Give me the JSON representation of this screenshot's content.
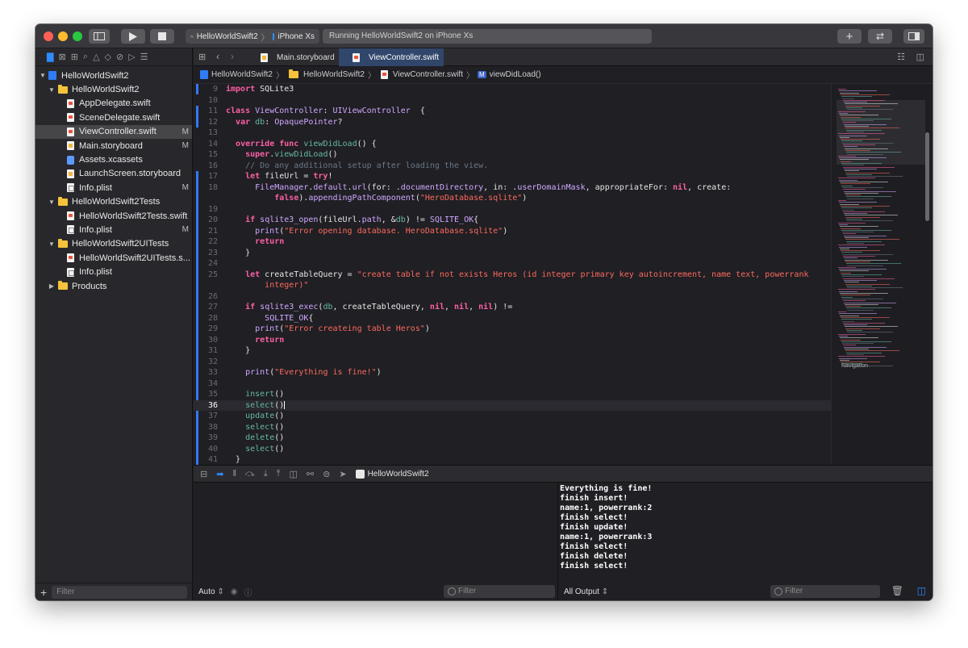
{
  "toolbar": {
    "scheme": "HelloWorldSwift2",
    "device": "iPhone Xs",
    "status": "Running HelloWorldSwift2 on iPhone Xs"
  },
  "navigator": {
    "items": [
      {
        "label": "HelloWorldSwift2",
        "kind": "project",
        "level": 0,
        "expanded": true,
        "badge": ""
      },
      {
        "label": "HelloWorldSwift2",
        "kind": "folder",
        "level": 1,
        "expanded": true,
        "badge": ""
      },
      {
        "label": "AppDelegate.swift",
        "kind": "swift",
        "level": 2,
        "badge": ""
      },
      {
        "label": "SceneDelegate.swift",
        "kind": "swift",
        "level": 2,
        "badge": ""
      },
      {
        "label": "ViewController.swift",
        "kind": "swift",
        "level": 2,
        "badge": "M",
        "selected": true
      },
      {
        "label": "Main.storyboard",
        "kind": "story",
        "level": 2,
        "badge": "M"
      },
      {
        "label": "Assets.xcassets",
        "kind": "assets",
        "level": 2,
        "badge": ""
      },
      {
        "label": "LaunchScreen.storyboard",
        "kind": "story",
        "level": 2,
        "badge": ""
      },
      {
        "label": "Info.plist",
        "kind": "plist",
        "level": 2,
        "badge": "M"
      },
      {
        "label": "HelloWorldSwift2Tests",
        "kind": "folder",
        "level": 1,
        "expanded": true,
        "badge": ""
      },
      {
        "label": "HelloWorldSwift2Tests.swift",
        "kind": "swift",
        "level": 2,
        "badge": ""
      },
      {
        "label": "Info.plist",
        "kind": "plist",
        "level": 2,
        "badge": "M"
      },
      {
        "label": "HelloWorldSwift2UITests",
        "kind": "folder",
        "level": 1,
        "expanded": true,
        "badge": ""
      },
      {
        "label": "HelloWorldSwift2UITests.s...",
        "kind": "swift",
        "level": 2,
        "badge": ""
      },
      {
        "label": "Info.plist",
        "kind": "plist",
        "level": 2,
        "badge": ""
      },
      {
        "label": "Products",
        "kind": "folder",
        "level": 1,
        "expanded": false,
        "badge": ""
      }
    ],
    "filter_placeholder": "Filter"
  },
  "tabs": [
    {
      "label": "Main.storyboard",
      "active": false
    },
    {
      "label": "ViewController.swift",
      "active": true
    }
  ],
  "jumpbar": {
    "project": "HelloWorldSwift2",
    "group": "HelloWorldSwift2",
    "file": "ViewController.swift",
    "symbol_badge": "M",
    "symbol": "viewDidLoad()"
  },
  "code_lines": [
    {
      "n": "9",
      "tokens": [
        [
          "kw",
          "import"
        ],
        [
          "t",
          " SQLite3"
        ]
      ]
    },
    {
      "n": "10",
      "tokens": []
    },
    {
      "n": "11",
      "tokens": [
        [
          "kw",
          "class"
        ],
        [
          "t",
          " "
        ],
        [
          "ty",
          "ViewController"
        ],
        [
          "t",
          ": "
        ],
        [
          "ty",
          "UIViewController"
        ],
        [
          "t",
          "  {"
        ]
      ]
    },
    {
      "n": "12",
      "tokens": [
        [
          "t",
          "  "
        ],
        [
          "kw",
          "var"
        ],
        [
          "t",
          " "
        ],
        [
          "fn",
          "db"
        ],
        [
          "t",
          ": "
        ],
        [
          "ty",
          "OpaquePointer"
        ],
        [
          "t",
          "?"
        ]
      ]
    },
    {
      "n": "13",
      "tokens": []
    },
    {
      "n": "14",
      "tokens": [
        [
          "t",
          "  "
        ],
        [
          "kw",
          "override"
        ],
        [
          "t",
          " "
        ],
        [
          "kw",
          "func"
        ],
        [
          "t",
          " "
        ],
        [
          "fn",
          "viewDidLoad"
        ],
        [
          "t",
          "() {"
        ]
      ]
    },
    {
      "n": "15",
      "tokens": [
        [
          "t",
          "    "
        ],
        [
          "kw",
          "super"
        ],
        [
          "t",
          "."
        ],
        [
          "fn",
          "viewDidLoad"
        ],
        [
          "t",
          "()"
        ]
      ]
    },
    {
      "n": "16",
      "tokens": [
        [
          "t",
          "    "
        ],
        [
          "cm",
          "// Do any additional setup after loading the view."
        ]
      ]
    },
    {
      "n": "17",
      "tokens": [
        [
          "t",
          "    "
        ],
        [
          "kw",
          "let"
        ],
        [
          "t",
          " fileUrl = "
        ],
        [
          "kw",
          "try"
        ],
        [
          "t",
          "!"
        ]
      ]
    },
    {
      "n": "18",
      "tokens": [
        [
          "t",
          "      "
        ],
        [
          "ty",
          "FileManager"
        ],
        [
          "t",
          "."
        ],
        [
          "ty",
          "default"
        ],
        [
          "t",
          "."
        ],
        [
          "ty",
          "url"
        ],
        [
          "t",
          "(for: ."
        ],
        [
          "ty",
          "documentDirectory"
        ],
        [
          "t",
          ", in: ."
        ],
        [
          "ty",
          "userDomainMask"
        ],
        [
          "t",
          ", appropriateFor: "
        ],
        [
          "kw",
          "nil"
        ],
        [
          "t",
          ", create:"
        ]
      ]
    },
    {
      "n": "",
      "tokens": [
        [
          "t",
          "          "
        ],
        [
          "kw",
          "false"
        ],
        [
          "t",
          ")."
        ],
        [
          "ty",
          "appendingPathComponent"
        ],
        [
          "t",
          "("
        ],
        [
          "str",
          "\"HeroDatabase.sqlite\""
        ],
        [
          "t",
          ")"
        ]
      ]
    },
    {
      "n": "19",
      "tokens": []
    },
    {
      "n": "20",
      "tokens": [
        [
          "t",
          "    "
        ],
        [
          "kw",
          "if"
        ],
        [
          "t",
          " "
        ],
        [
          "ty",
          "sqlite3_open"
        ],
        [
          "t",
          "(fileUrl."
        ],
        [
          "ty",
          "path"
        ],
        [
          "t",
          ", &"
        ],
        [
          "fn",
          "db"
        ],
        [
          "t",
          ") != "
        ],
        [
          "ty",
          "SQLITE_OK"
        ],
        [
          "t",
          "{"
        ]
      ]
    },
    {
      "n": "21",
      "tokens": [
        [
          "t",
          "      "
        ],
        [
          "ty",
          "print"
        ],
        [
          "t",
          "("
        ],
        [
          "str",
          "\"Error opening database. HeroDatabase.sqlite\""
        ],
        [
          "t",
          ")"
        ]
      ]
    },
    {
      "n": "22",
      "tokens": [
        [
          "t",
          "      "
        ],
        [
          "kw",
          "return"
        ]
      ]
    },
    {
      "n": "23",
      "tokens": [
        [
          "t",
          "    }"
        ]
      ]
    },
    {
      "n": "24",
      "tokens": []
    },
    {
      "n": "25",
      "tokens": [
        [
          "t",
          "    "
        ],
        [
          "kw",
          "let"
        ],
        [
          "t",
          " createTableQuery = "
        ],
        [
          "str",
          "\"create table if not exists Heros (id integer primary key autoincrement, name text, powerrank"
        ]
      ]
    },
    {
      "n": "",
      "tokens": [
        [
          "t",
          "        "
        ],
        [
          "str",
          "integer)\""
        ]
      ]
    },
    {
      "n": "26",
      "tokens": []
    },
    {
      "n": "27",
      "tokens": [
        [
          "t",
          "    "
        ],
        [
          "kw",
          "if"
        ],
        [
          "t",
          " "
        ],
        [
          "ty",
          "sqlite3_exec"
        ],
        [
          "t",
          "("
        ],
        [
          "fn",
          "db"
        ],
        [
          "t",
          ", createTableQuery, "
        ],
        [
          "kw",
          "nil"
        ],
        [
          "t",
          ", "
        ],
        [
          "kw",
          "nil"
        ],
        [
          "t",
          ", "
        ],
        [
          "kw",
          "nil"
        ],
        [
          "t",
          ") !="
        ]
      ]
    },
    {
      "n": "28",
      "tokens": [
        [
          "t",
          "        "
        ],
        [
          "ty",
          "SQLITE_OK"
        ],
        [
          "t",
          "{"
        ]
      ]
    },
    {
      "n": "29",
      "tokens": [
        [
          "t",
          "      "
        ],
        [
          "ty",
          "print"
        ],
        [
          "t",
          "("
        ],
        [
          "str",
          "\"Error createing table Heros\""
        ],
        [
          "t",
          ")"
        ]
      ]
    },
    {
      "n": "30",
      "tokens": [
        [
          "t",
          "      "
        ],
        [
          "kw",
          "return"
        ]
      ]
    },
    {
      "n": "31",
      "tokens": [
        [
          "t",
          "    }"
        ]
      ]
    },
    {
      "n": "32",
      "tokens": []
    },
    {
      "n": "33",
      "tokens": [
        [
          "t",
          "    "
        ],
        [
          "ty",
          "print"
        ],
        [
          "t",
          "("
        ],
        [
          "str",
          "\"Everything is fine!\""
        ],
        [
          "t",
          ")"
        ]
      ]
    },
    {
      "n": "34",
      "tokens": []
    },
    {
      "n": "35",
      "tokens": [
        [
          "t",
          "    "
        ],
        [
          "fn",
          "insert"
        ],
        [
          "t",
          "()"
        ]
      ]
    },
    {
      "n": "36",
      "tokens": [
        [
          "t",
          "    "
        ],
        [
          "fn",
          "select"
        ],
        [
          "t",
          "()"
        ]
      ],
      "current": true
    },
    {
      "n": "37",
      "tokens": [
        [
          "t",
          "    "
        ],
        [
          "fn",
          "update"
        ],
        [
          "t",
          "()"
        ]
      ]
    },
    {
      "n": "38",
      "tokens": [
        [
          "t",
          "    "
        ],
        [
          "fn",
          "select"
        ],
        [
          "t",
          "()"
        ]
      ]
    },
    {
      "n": "39",
      "tokens": [
        [
          "t",
          "    "
        ],
        [
          "fn",
          "delete"
        ],
        [
          "t",
          "()"
        ]
      ]
    },
    {
      "n": "40",
      "tokens": [
        [
          "t",
          "    "
        ],
        [
          "fn",
          "select"
        ],
        [
          "t",
          "()"
        ]
      ]
    },
    {
      "n": "41",
      "tokens": [
        [
          "t",
          "  }"
        ]
      ]
    }
  ],
  "minimap": {
    "label": "Navigation"
  },
  "debug": {
    "target": "HelloWorldSwift2",
    "variables_scope": "Auto",
    "variables_filter_placeholder": "Filter",
    "output_scope": "All Output",
    "output_filter_placeholder": "Filter",
    "console_lines": [
      "Everything is fine!",
      "finish insert!",
      "name:1, powerrank:2",
      "finish select!",
      "finish update!",
      "name:1, powerrank:3",
      "finish select!",
      "finish delete!",
      "finish select!"
    ]
  },
  "colors": {
    "accent": "#2f8cff",
    "keyword": "#fc5fa3",
    "type": "#d0a8ff",
    "string": "#fc6a5d",
    "comment": "#6c7986",
    "function": "#67b7a4"
  }
}
